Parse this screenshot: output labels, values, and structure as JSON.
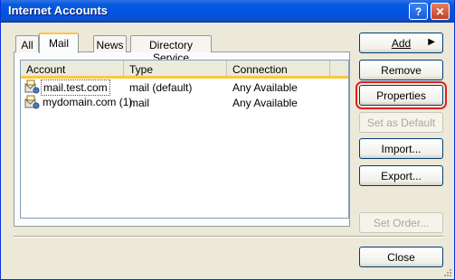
{
  "window": {
    "title": "Internet Accounts",
    "help_label": "?",
    "close_label": "✕"
  },
  "tabs": [
    {
      "label": "All",
      "active": false
    },
    {
      "label": "Mail",
      "active": true
    },
    {
      "label": "News",
      "active": false
    },
    {
      "label": "Directory Service",
      "active": false
    }
  ],
  "list": {
    "columns": [
      "Account",
      "Type",
      "Connection"
    ],
    "rows": [
      {
        "account": "mail.test.com",
        "type": "mail (default)",
        "connection": "Any Available",
        "selected": true
      },
      {
        "account": "mydomain.com (1)",
        "type": "mail",
        "connection": "Any Available",
        "selected": false
      }
    ]
  },
  "buttons": {
    "add": "Add",
    "remove": "Remove",
    "properties": "Properties",
    "set_default": "Set as Default",
    "import": "Import...",
    "export": "Export...",
    "set_order": "Set Order...",
    "close": "Close"
  },
  "colors": {
    "title_bar": "#0054E3",
    "face": "#ECE9D8",
    "tab_highlight": "#FFC73C",
    "focus_outline": "#E31E24"
  }
}
